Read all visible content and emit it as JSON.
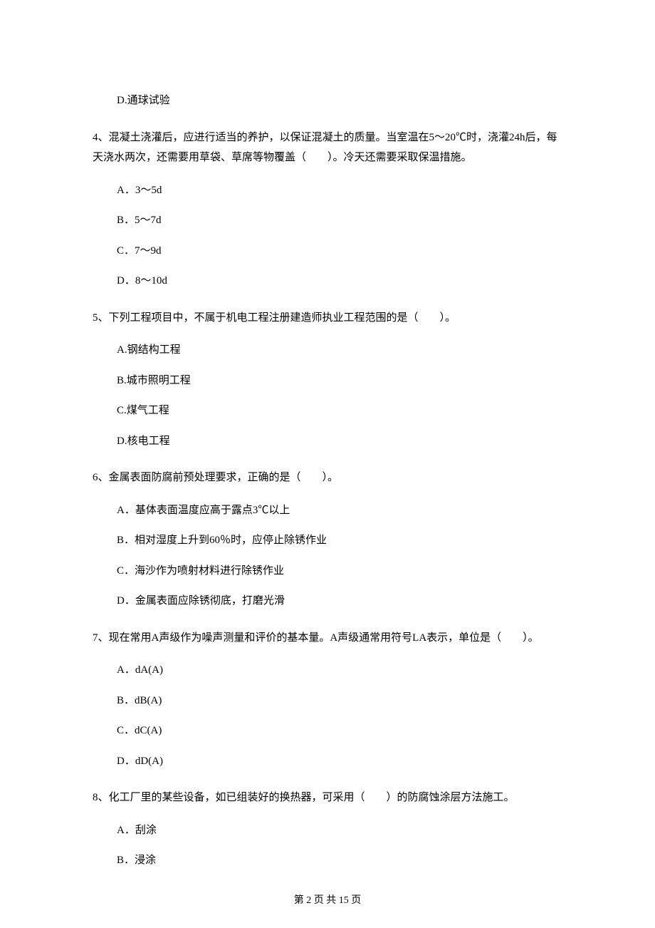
{
  "q3": {
    "optD": "D.通球试验"
  },
  "q4": {
    "stem": "4、混凝土浇灌后，应进行适当的养护，以保证混凝土的质量。当室温在5～20℃时，浇灌24h后，每天浇水两次，还需要用草袋、草席等物覆盖（　　）。冷天还需要采取保温措施。",
    "optA": "A．3～5d",
    "optB": "B．5～7d",
    "optC": "C．7～9d",
    "optD": "D．8～10d"
  },
  "q5": {
    "stem": "5、下列工程项目中，不属于机电工程注册建造师执业工程范围的是（　　）。",
    "optA": "A.钢结构工程",
    "optB": "B.城市照明工程",
    "optC": "C.煤气工程",
    "optD": "D.核电工程"
  },
  "q6": {
    "stem": "6、金属表面防腐前预处理要求，正确的是（　　）。",
    "optA": "A．基体表面温度应高于露点3℃以上",
    "optB": "B．相对湿度上升到60％时，应停止除锈作业",
    "optC": "C．海沙作为喷射材料进行除锈作业",
    "optD": "D．金属表面应除锈彻底，打磨光滑"
  },
  "q7": {
    "stem": "7、现在常用A声级作为噪声测量和评价的基本量。A声级通常用符号LA表示，单位是（　　）。",
    "optA": "A．dA(A)",
    "optB": "B．dB(A)",
    "optC": "C．dC(A)",
    "optD": "D．dD(A)"
  },
  "q8": {
    "stem": "8、化工厂里的某些设备，如已组装好的换热器，可采用（　　）的防腐蚀涂层方法施工。",
    "optA": "A．刮涂",
    "optB": "B．浸涂"
  },
  "footer": "第 2 页 共 15 页"
}
